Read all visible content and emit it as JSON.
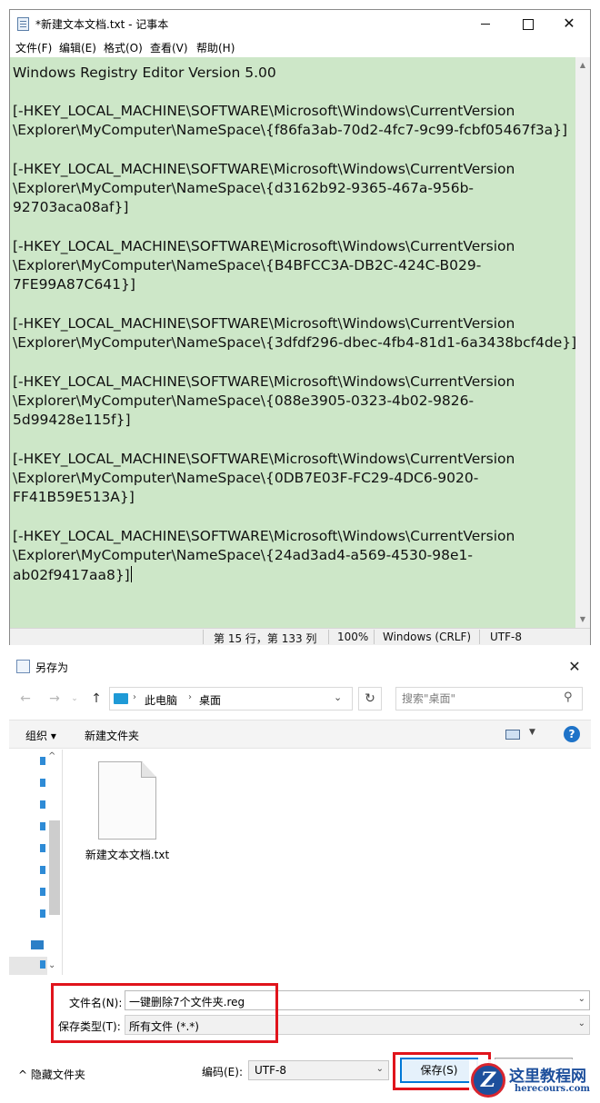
{
  "notepad": {
    "title": "*新建文本文档.txt - 记事本",
    "menu": [
      "文件(F)",
      "编辑(E)",
      "格式(O)",
      "查看(V)",
      "帮助(H)"
    ],
    "lines": [
      "Windows Registry Editor Version 5.00",
      "",
      "[-HKEY_LOCAL_MACHINE\\SOFTWARE\\Microsoft\\Windows\\CurrentVersion",
      "\\Explorer\\MyComputer\\NameSpace\\{f86fa3ab-70d2-4fc7-9c99-fcbf05467f3a}]",
      "",
      "[-HKEY_LOCAL_MACHINE\\SOFTWARE\\Microsoft\\Windows\\CurrentVersion",
      "\\Explorer\\MyComputer\\NameSpace\\{d3162b92-9365-467a-956b-",
      "92703aca08af}]",
      "",
      "[-HKEY_LOCAL_MACHINE\\SOFTWARE\\Microsoft\\Windows\\CurrentVersion",
      "\\Explorer\\MyComputer\\NameSpace\\{B4BFCC3A-DB2C-424C-B029-",
      "7FE99A87C641}]",
      "",
      "[-HKEY_LOCAL_MACHINE\\SOFTWARE\\Microsoft\\Windows\\CurrentVersion",
      "\\Explorer\\MyComputer\\NameSpace\\{3dfdf296-dbec-4fb4-81d1-6a3438bcf4de}]",
      "",
      "[-HKEY_LOCAL_MACHINE\\SOFTWARE\\Microsoft\\Windows\\CurrentVersion",
      "\\Explorer\\MyComputer\\NameSpace\\{088e3905-0323-4b02-9826-",
      "5d99428e115f}]",
      "",
      "[-HKEY_LOCAL_MACHINE\\SOFTWARE\\Microsoft\\Windows\\CurrentVersion",
      "\\Explorer\\MyComputer\\NameSpace\\{0DB7E03F-FC29-4DC6-9020-",
      "FF41B59E513A}]",
      "",
      "[-HKEY_LOCAL_MACHINE\\SOFTWARE\\Microsoft\\Windows\\CurrentVersion",
      "\\Explorer\\MyComputer\\NameSpace\\{24ad3ad4-a569-4530-98e1-",
      "ab02f9417aa8}]"
    ],
    "status": {
      "position": "第 15 行，第 133 列",
      "zoom": "100%",
      "line_ending": "Windows (CRLF)",
      "encoding": "UTF-8"
    },
    "editor_bg": "#cde7c8"
  },
  "save_dialog": {
    "title": "另存为",
    "breadcrumb": [
      "此电脑",
      "桌面"
    ],
    "search_placeholder": "搜索\"桌面\"",
    "organize_label": "组织 ▾",
    "new_folder_label": "新建文件夹",
    "file": {
      "name": "新建文本文档.txt",
      "icon": "text-document-icon"
    },
    "filename_label": "文件名(N):",
    "filename_value": "一键删除7个文件夹.reg",
    "filetype_label": "保存类型(T):",
    "filetype_value": "所有文件  (*.*)",
    "hide_folders_label": "隐藏文件夹",
    "encoding_label": "编码(E):",
    "encoding_value": "UTF-8",
    "save_label": "保存(S)",
    "highlight_color": "#e0141c"
  },
  "watermark": {
    "brand": "这里教程网",
    "url": "herecours.com"
  }
}
